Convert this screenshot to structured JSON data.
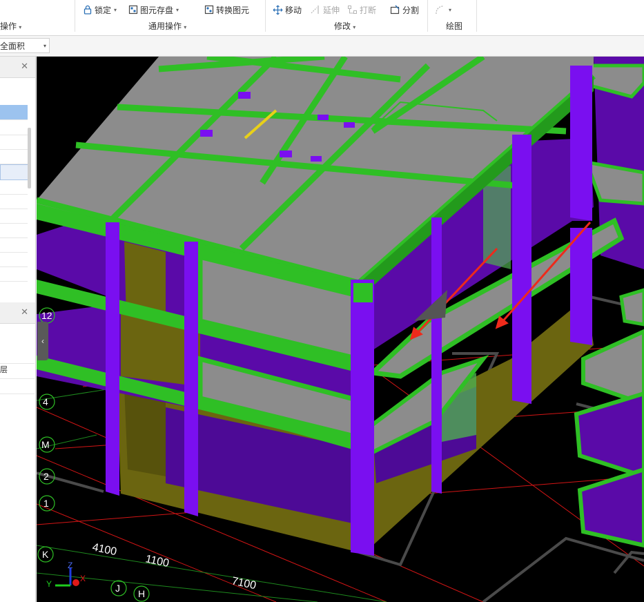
{
  "ribbon": {
    "left_group_label": "操作",
    "general_ops": {
      "lock": "锁定",
      "save_element": "图元存盘",
      "convert": "转换图元",
      "group_label": "通用操作"
    },
    "modify": {
      "move": "移动",
      "extend": "延伸",
      "break": "打断",
      "split": "分割",
      "group_label": "修改"
    },
    "draw": {
      "arc_icon": "arc-draw-icon",
      "group_label": "绘图"
    }
  },
  "property_bar": {
    "selected": "全面积"
  },
  "left_panel": {
    "floor_item": "层"
  },
  "viewport": {
    "axis_labels": [
      "12",
      "4",
      "M",
      "2",
      "1",
      "K",
      "J",
      "H"
    ],
    "dimensions": [
      "4100",
      "1100",
      "7100"
    ],
    "triad": {
      "x": "X",
      "y": "Y",
      "z": "Z"
    }
  },
  "colors": {
    "slab": "#8c8c8c",
    "beam": "#2fbf25",
    "column": "#7a0ff0",
    "wall": "#6b6510",
    "grid_red": "#e01818",
    "grid_green": "#1e8a1e",
    "selection_arrow": "#ee2a1b"
  }
}
